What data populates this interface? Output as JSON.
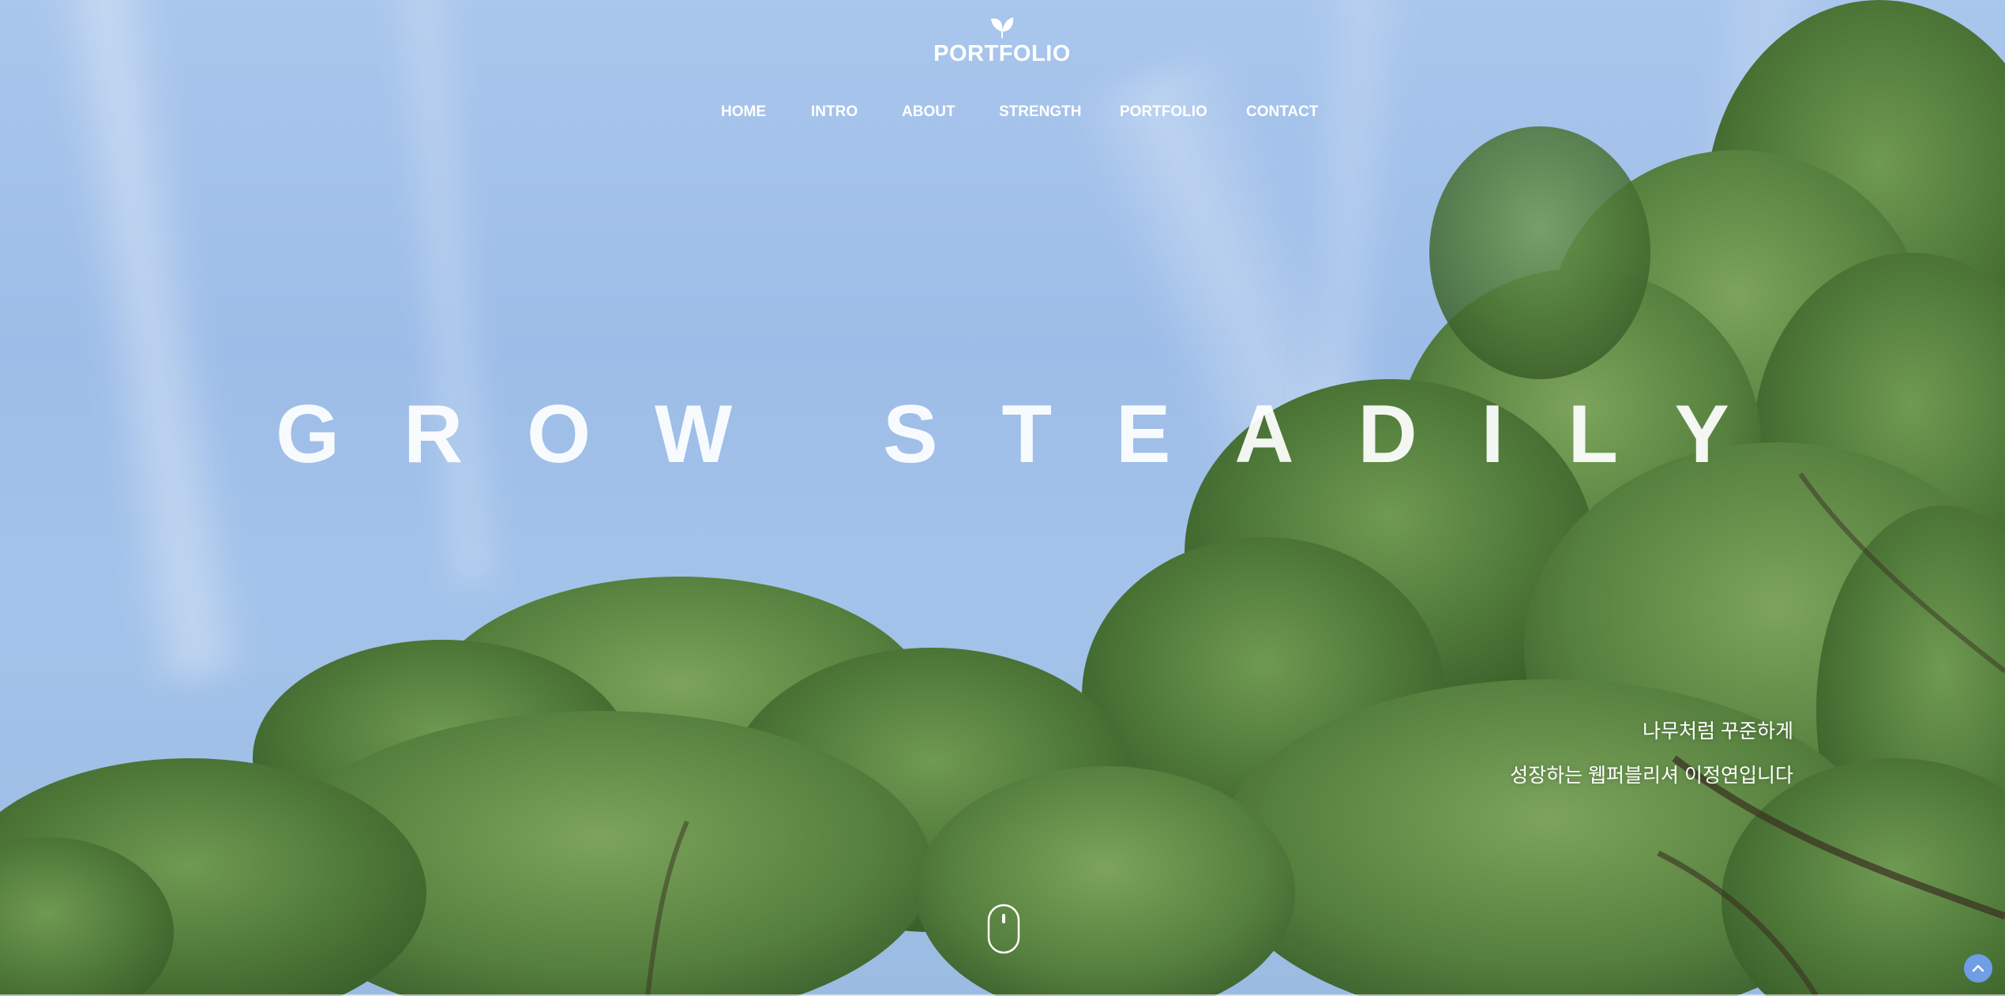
{
  "logo": {
    "icon": "leaf-icon",
    "text": "PORTFOLIO"
  },
  "nav": {
    "items": [
      {
        "label": "HOME"
      },
      {
        "label": "INTRO"
      },
      {
        "label": "ABOUT"
      },
      {
        "label": "STRENGTH"
      },
      {
        "label": "PORTFOLIO"
      },
      {
        "label": "CONTACT"
      }
    ]
  },
  "hero": {
    "headline": "GROW STEADILY",
    "tagline_line1": "나무처럼 꾸준하게",
    "tagline_line2": "성장하는 웹퍼블리셔 이정연입니다",
    "scroll_icon": "mouse-scroll-icon",
    "top_button_icon": "chevron-up-icon"
  },
  "colors": {
    "sky": "#a3c3ea",
    "foliage": "#4f7a3a",
    "text": "#ffffff",
    "top_button": "#6f9ee6"
  }
}
